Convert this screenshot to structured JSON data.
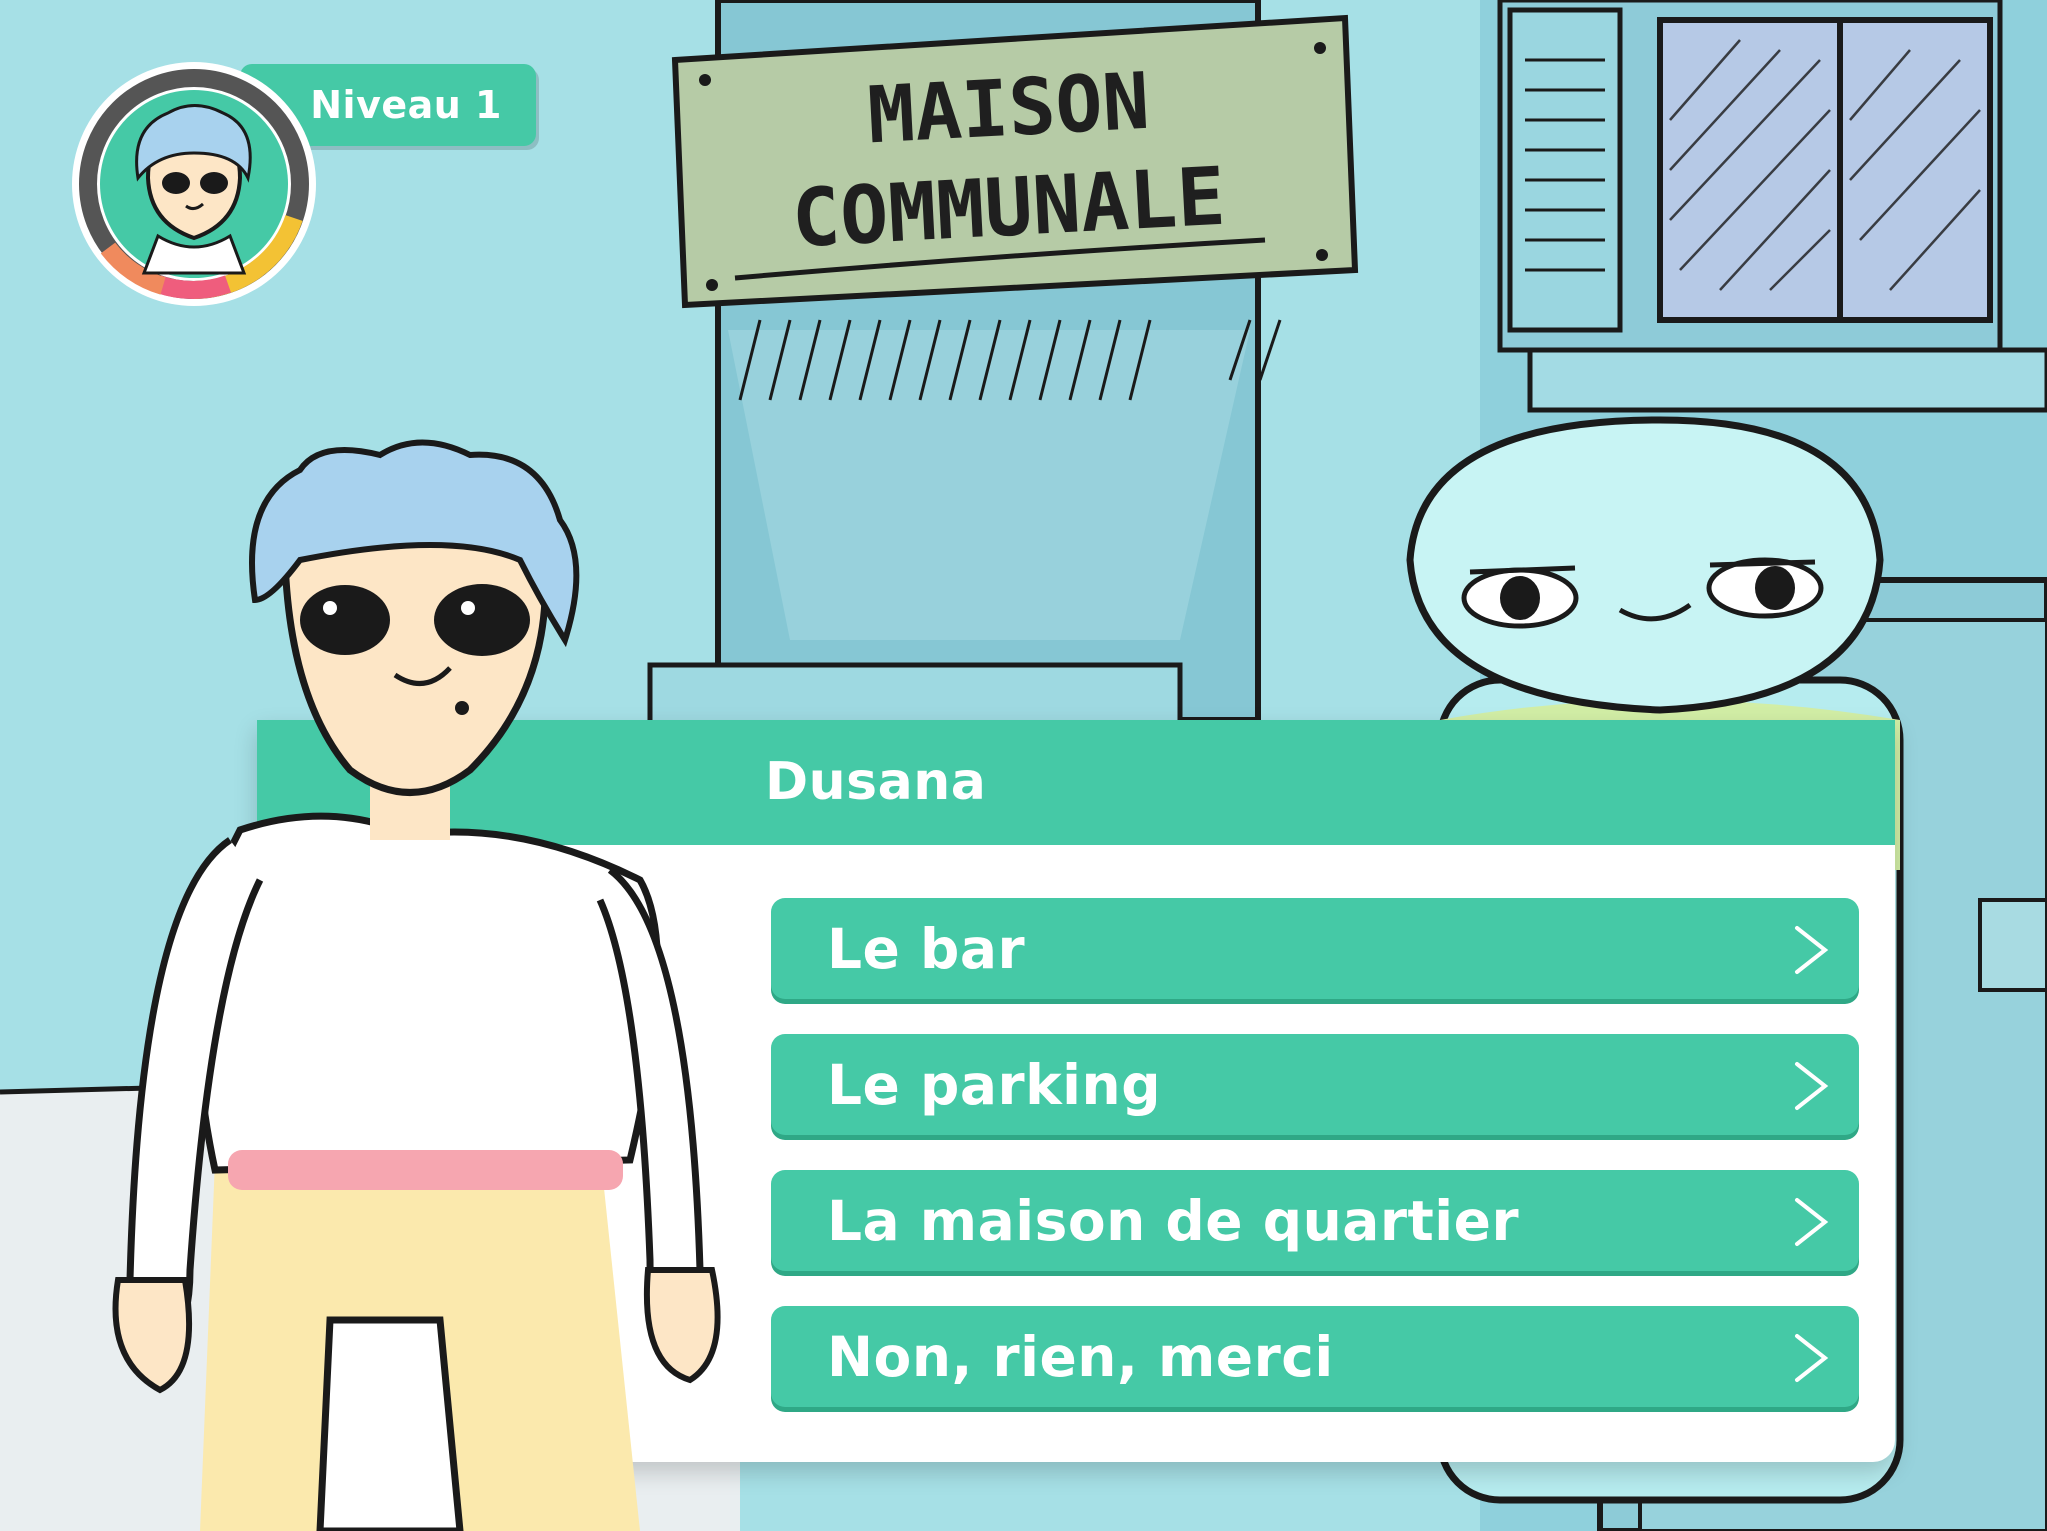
{
  "scene": {
    "sign_line1": "MAISON",
    "sign_line2": "COMMUNALE"
  },
  "hud": {
    "level_label": "Niveau 1"
  },
  "dialog": {
    "speaker": "Dusana",
    "choices": [
      {
        "label": "Le bar",
        "icon": "chevron-right-icon"
      },
      {
        "label": "Le parking",
        "icon": "chevron-right-icon"
      },
      {
        "label": "La maison de quartier",
        "icon": "chevron-right-icon"
      },
      {
        "label": "Non, rien, merci",
        "icon": "chevron-right-icon"
      }
    ]
  },
  "colors": {
    "accent": "#45c9a6",
    "sky": "#9fdfe4",
    "wall": "#84c8d3",
    "sign": "#b6cba6"
  }
}
